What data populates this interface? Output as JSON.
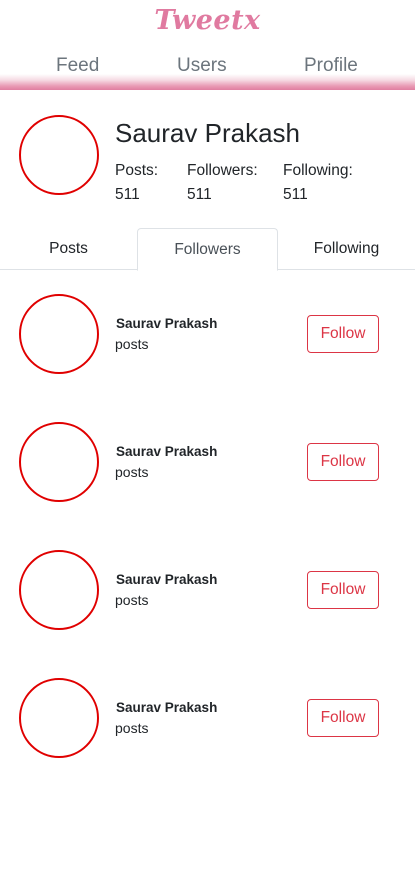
{
  "app": {
    "logo": "Tweetx"
  },
  "nav": {
    "items": [
      {
        "label": "Feed"
      },
      {
        "label": "Users"
      },
      {
        "label": "Profile"
      }
    ]
  },
  "profile": {
    "name": "Saurav Prakash",
    "stats": [
      {
        "label": "Posts:",
        "value": "511"
      },
      {
        "label": "Followers:",
        "value": "511"
      },
      {
        "label": "Following:",
        "value": "511"
      }
    ]
  },
  "tabs": {
    "items": [
      {
        "label": "Posts"
      },
      {
        "label": "Followers"
      },
      {
        "label": "Following"
      }
    ],
    "active": "Followers"
  },
  "followers": [
    {
      "name": "Saurav Prakash",
      "subtitle": "posts",
      "action": "Follow"
    },
    {
      "name": "Saurav Prakash",
      "subtitle": "posts",
      "action": "Follow"
    },
    {
      "name": "Saurav Prakash",
      "subtitle": "posts",
      "action": "Follow"
    },
    {
      "name": "Saurav Prakash",
      "subtitle": "posts",
      "action": "Follow"
    }
  ],
  "colors": {
    "brand": "#e07aa0",
    "avatar_ring": "#e00000",
    "follow": "#dc3545"
  }
}
